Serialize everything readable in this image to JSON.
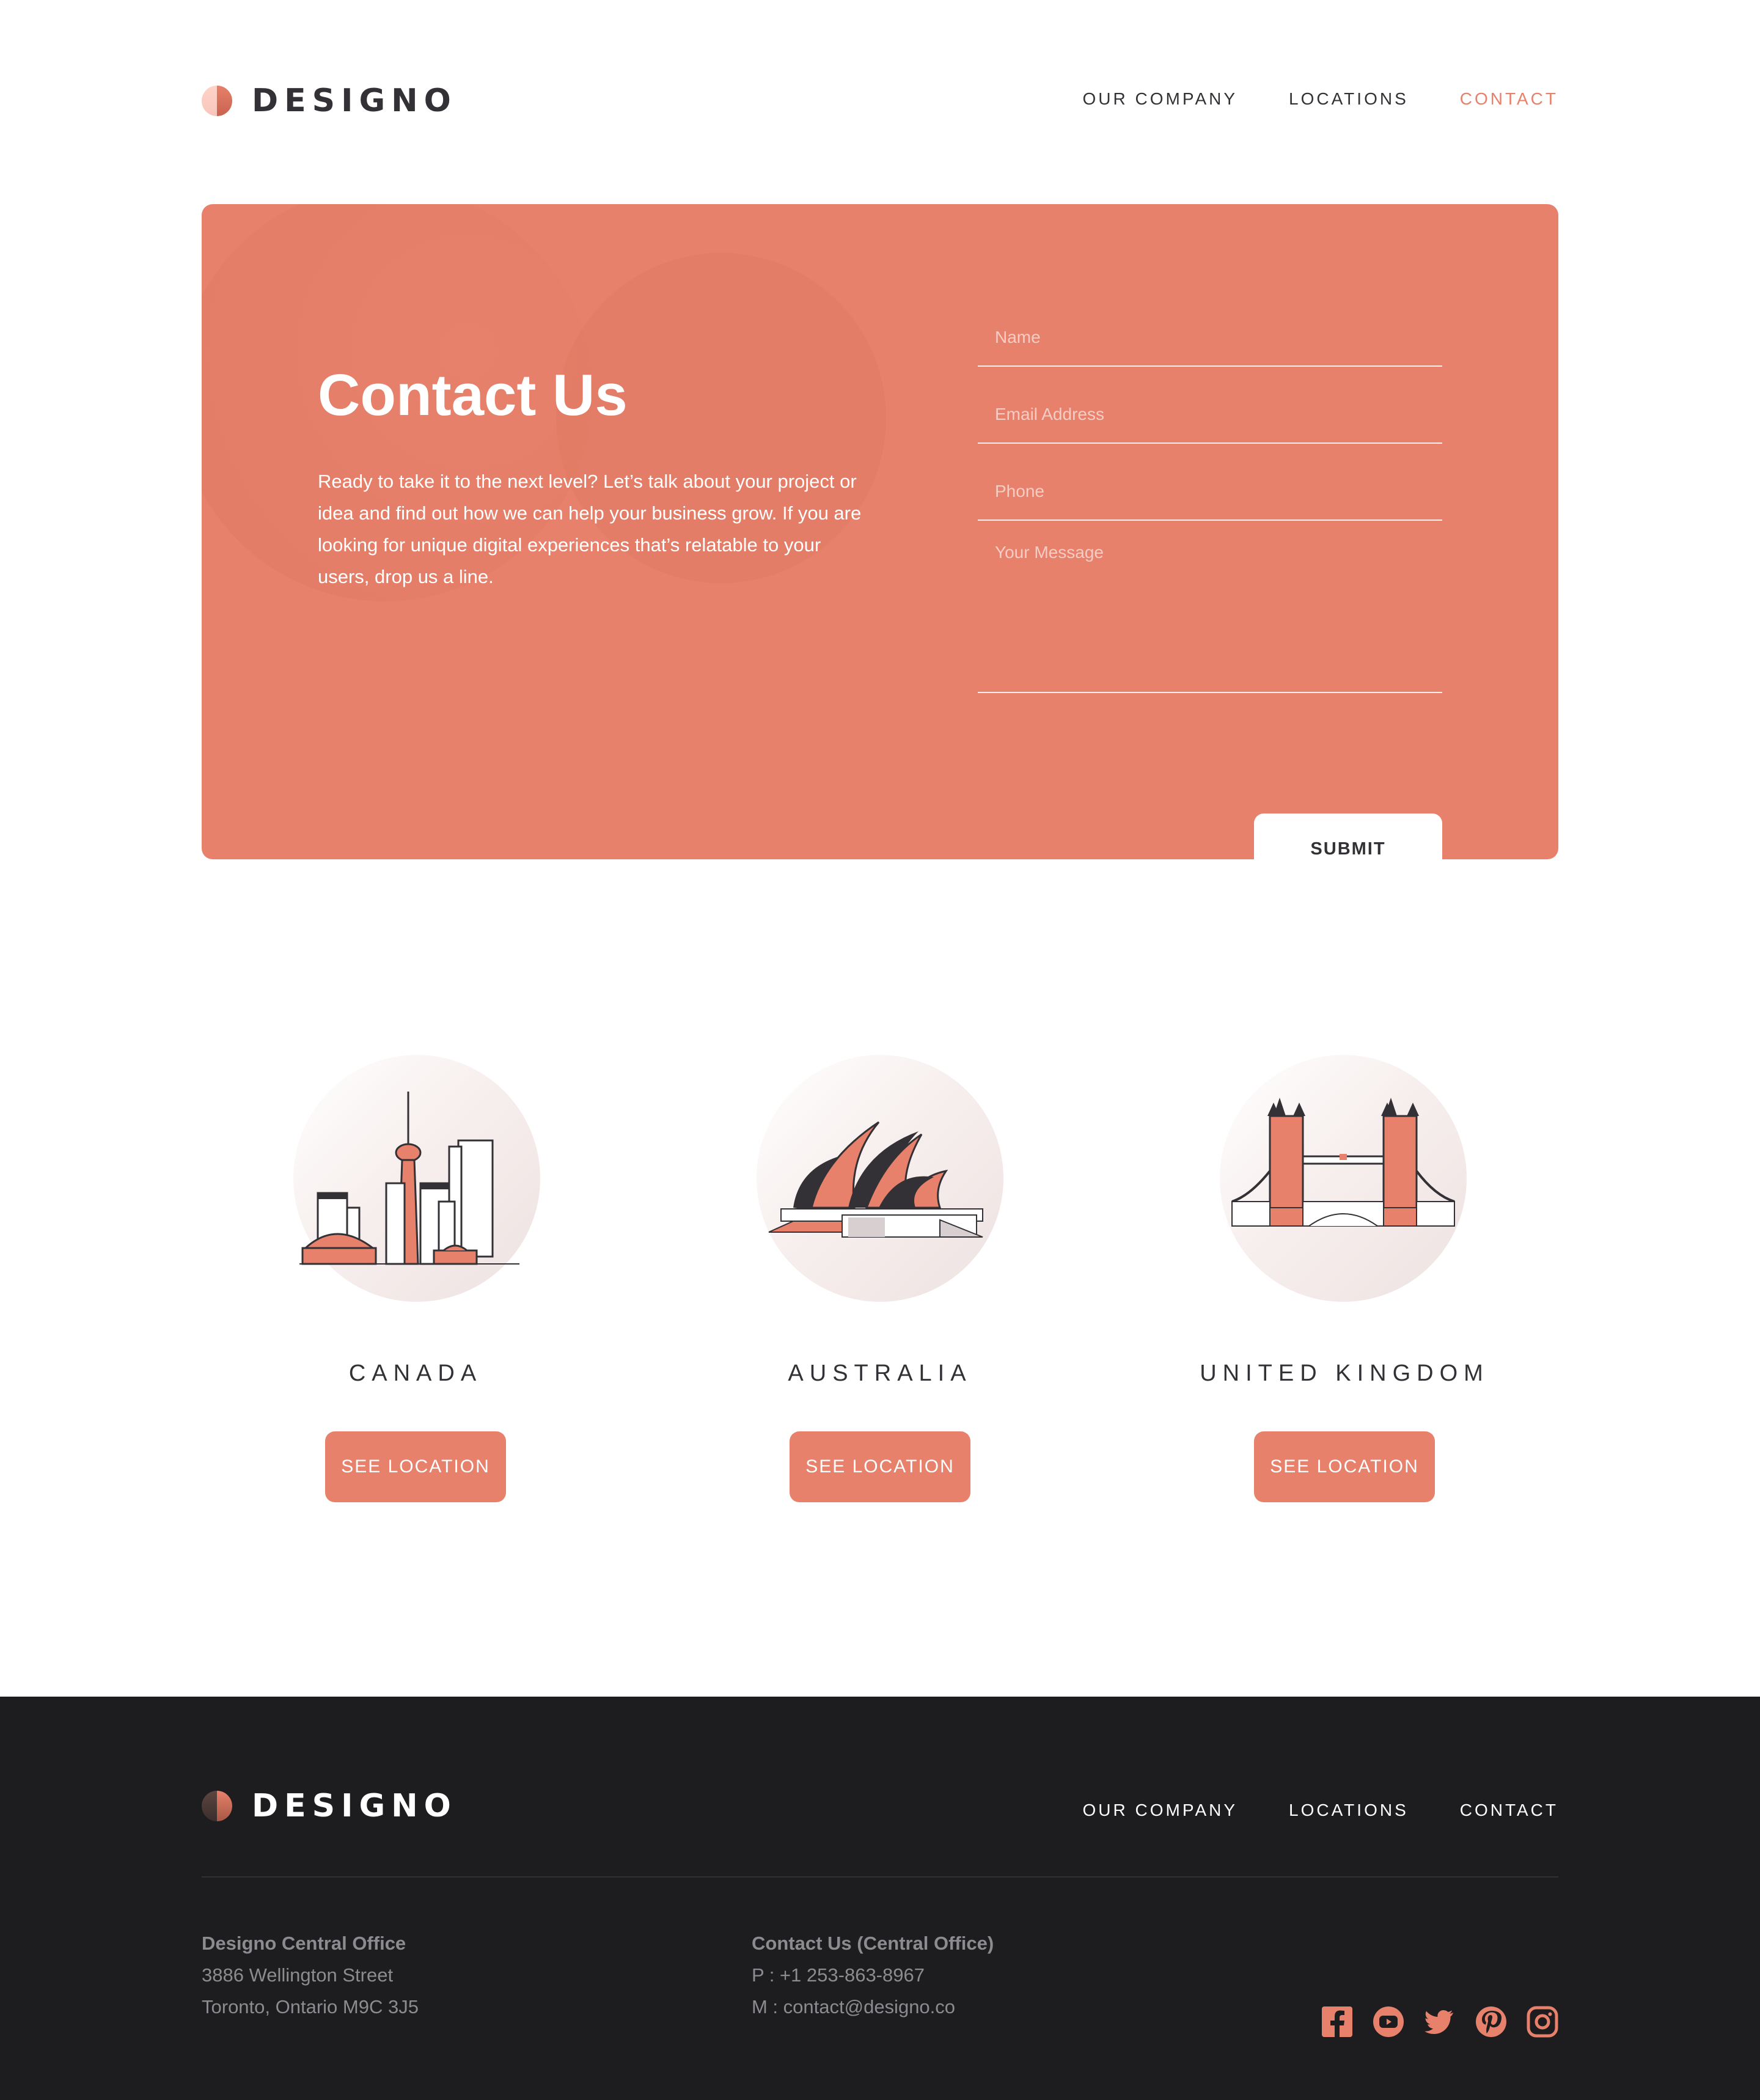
{
  "brand": {
    "name": "DESIGNO"
  },
  "nav": {
    "items": [
      {
        "label": "OUR COMPANY"
      },
      {
        "label": "LOCATIONS"
      },
      {
        "label": "CONTACT"
      }
    ],
    "active": "CONTACT"
  },
  "contact": {
    "title": "Contact Us",
    "text": "Ready to take it to the next level? Let’s talk about your project or idea and find out how we can help your business grow. If you are looking for unique digital experiences that’s relatable to your users, drop us a line.",
    "form": {
      "name_placeholder": "Name",
      "email_placeholder": "Email Address",
      "phone_placeholder": "Phone",
      "message_placeholder": "Your Message",
      "submit_label": "SUBMIT"
    }
  },
  "locations": [
    {
      "name": "CANADA",
      "button": "SEE LOCATION",
      "icon": "toronto-skyline-illustration"
    },
    {
      "name": "AUSTRALIA",
      "button": "SEE LOCATION",
      "icon": "sydney-opera-house-illustration"
    },
    {
      "name": "UNITED KINGDOM",
      "button": "SEE LOCATION",
      "icon": "tower-bridge-illustration"
    }
  ],
  "footer": {
    "office": {
      "heading": "Designo Central Office",
      "line1": "3886 Wellington Street",
      "line2": "Toronto, Ontario M9C 3J5"
    },
    "contact": {
      "heading": "Contact Us (Central Office)",
      "phone": "P : +1 253-863-8967",
      "email": "M : contact@designo.co"
    },
    "socials": [
      "facebook-icon",
      "youtube-icon",
      "twitter-icon",
      "pinterest-icon",
      "instagram-icon"
    ]
  },
  "colors": {
    "accent": "#e7816b",
    "dark": "#1d1c1e",
    "text": "#333136"
  }
}
